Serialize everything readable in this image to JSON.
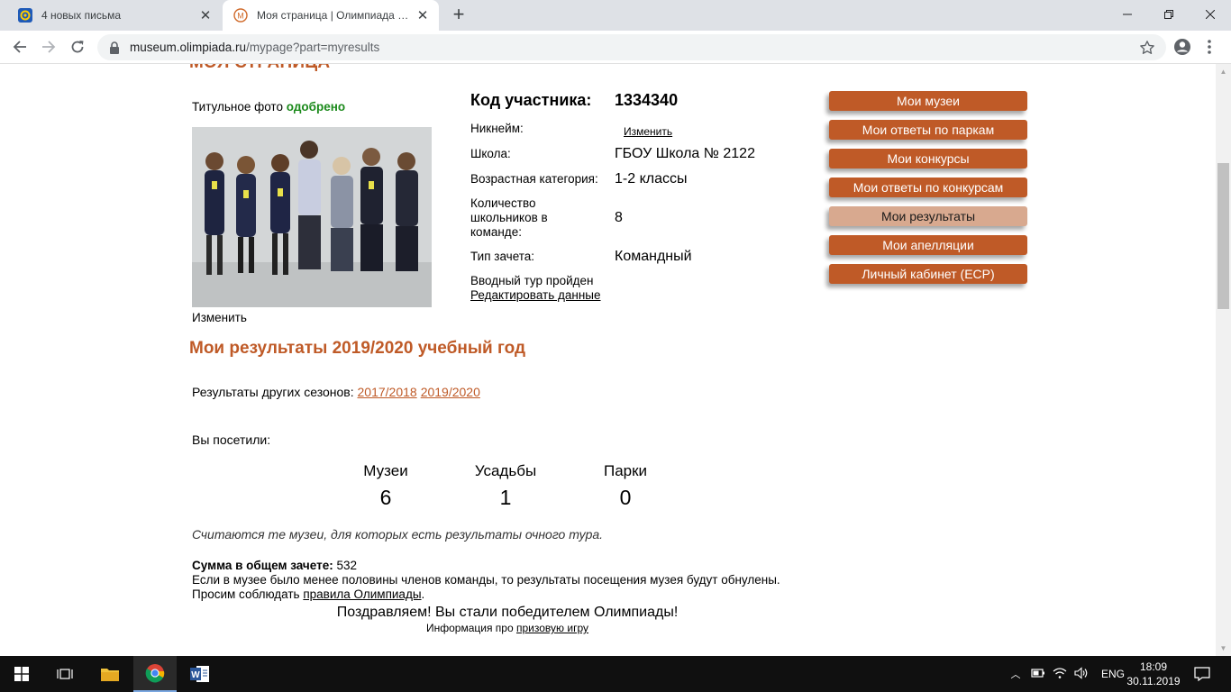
{
  "browser": {
    "tabs": [
      {
        "title": "4 новых письма",
        "active": false
      },
      {
        "title": "Моя страница | Олимпиада «Музеи. Парки. Усадьбы»",
        "active": true
      }
    ],
    "url": {
      "host": "museum.olimpiada.ru",
      "path": "/mypage?part=myresults"
    }
  },
  "page": {
    "heading": "МОЯ СТРАНИЦА",
    "photo": {
      "status_prefix": "Титульное фото",
      "status_value": "одобрено",
      "change_label": "Изменить"
    },
    "participant": {
      "code_label": "Код участника:",
      "code_value": "1334340",
      "nickname_label": "Никнейм:",
      "nickname_change": "Изменить",
      "school_label": "Школа:",
      "school_value": "ГБОУ Школа № 2122",
      "age_label": "Возрастная категория:",
      "age_value": "1-2 классы",
      "count_label": "Количество школьников в команде:",
      "count_value": "8",
      "type_label": "Тип зачета:",
      "type_value": "Командный",
      "intro_done": "Вводный тур пройден",
      "edit_link": "Редактировать данные"
    },
    "menu": [
      {
        "label": "Мои музеи",
        "active": false
      },
      {
        "label": "Мои ответы по паркам",
        "active": false
      },
      {
        "label": "Мои конкурсы",
        "active": false
      },
      {
        "label": "Мои ответы по конкурсам",
        "active": false
      },
      {
        "label": "Мои результаты",
        "active": true
      },
      {
        "label": "Мои апелляции",
        "active": false
      },
      {
        "label": "Личный кабинет (ЕСР)",
        "active": false
      }
    ],
    "results": {
      "title": "Мои результаты 2019/2020 учебный год",
      "seasons_label": "Результаты других сезонов:",
      "seasons": [
        "2017/2018",
        "2019/2020"
      ],
      "visited_label": "Вы посетили:",
      "stats": [
        {
          "label": "Музеи",
          "value": "6"
        },
        {
          "label": "Усадьбы",
          "value": "1"
        },
        {
          "label": "Парки",
          "value": "0"
        }
      ],
      "note": "Считаются те музеи, для которых есть результаты очного тура.",
      "sum_label": "Сумма в общем зачете:",
      "sum_value": "532",
      "warning": "Если в музее было менее половины членов команды, то результаты посещения музея будут обнулены.",
      "rules_prefix": "Просим соблюдать",
      "rules_link": "правила Олимпиады",
      "rules_suffix": ".",
      "congrats": "Поздравляем! Вы стали победителем Олимпиады!",
      "prize_prefix": "Информация про",
      "prize_link": "призовую игру"
    }
  },
  "taskbar": {
    "language": "ENG",
    "time": "18:09",
    "date": "30.11.2019"
  },
  "colors": {
    "accent": "#bf5a27",
    "menu_active": "#d8a98f",
    "approved": "#1b8a1b"
  }
}
